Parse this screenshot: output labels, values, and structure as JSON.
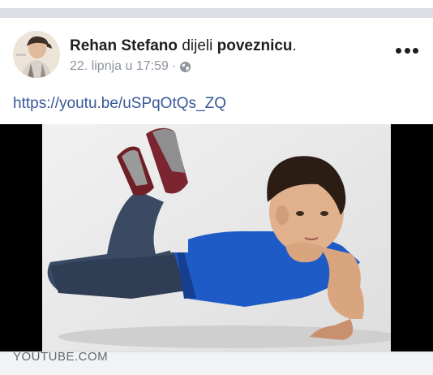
{
  "post": {
    "author": "Rehan Stefano",
    "verb": "dijeli",
    "object": "poveznicu",
    "period": ".",
    "timestamp": "22. lipnja u 17:59",
    "separator": "·",
    "privacy_icon": "globe-icon",
    "more_icon": "more-options-icon",
    "link_url": "https://youtu.be/uSPqOtQs_ZQ"
  },
  "preview": {
    "domain": "YOUTUBE.COM"
  },
  "colors": {
    "link": "#385898",
    "meta": "#8d949e",
    "background": "#e9ebee"
  }
}
